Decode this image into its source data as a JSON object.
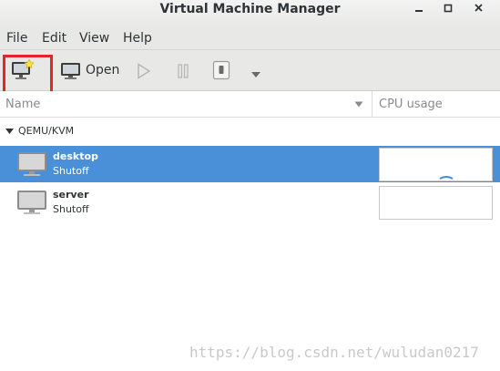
{
  "window": {
    "title": "Virtual Machine Manager",
    "controls": [
      "minimize-icon",
      "maximize-icon",
      "close-icon"
    ]
  },
  "menubar": {
    "items": [
      {
        "label": "File"
      },
      {
        "label": "Edit"
      },
      {
        "label": "View"
      },
      {
        "label": "Help"
      }
    ]
  },
  "toolbar": {
    "new_vm_icon": "new-vm-icon",
    "open_label": "Open",
    "run_icon": "play-icon",
    "pause_icon": "pause-icon",
    "shutdown_icon": "shutdown-icon",
    "menu_icon": "chevron-down-icon",
    "highlight_color": "#e4252b"
  },
  "columns": {
    "name": "Name",
    "cpu": "CPU usage"
  },
  "connection": {
    "label": "QEMU/KVM",
    "vms": [
      {
        "name": "desktop",
        "status": "Shutoff",
        "selected": true
      },
      {
        "name": "server",
        "status": "Shutoff",
        "selected": false
      }
    ]
  },
  "watermark": "https://blog.csdn.net/wuludan0217",
  "colors": {
    "selection": "#4a90d9",
    "chrome": "#e8e8e7"
  }
}
